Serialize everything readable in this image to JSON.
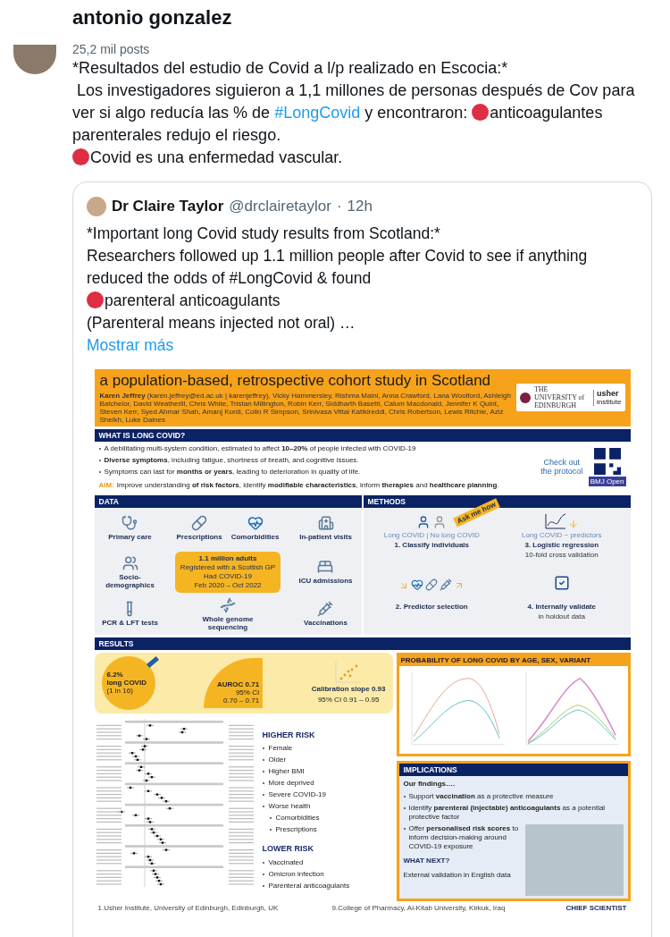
{
  "post": {
    "author": "antonio gonzalez",
    "post_count": "25,2 mil posts",
    "paragraphs": [
      {
        "segments": [
          {
            "kind": "text",
            "text": "*Resultados del estudio de Covid a l/p realizado en Escocia:*"
          }
        ]
      },
      {
        "segments": [
          {
            "kind": "text",
            "text": " Los investigadores siguieron a 1,1 millones de personas después de Cov para ver si algo reducía las % de "
          },
          {
            "kind": "hashtag",
            "text": "#LongCovid"
          },
          {
            "kind": "text",
            "text": " y encontraron: "
          },
          {
            "kind": "dot"
          },
          {
            "kind": "text",
            "text": "anticoagulantes parenterales redujo el riesgo."
          }
        ]
      },
      {
        "segments": [
          {
            "kind": "dot"
          },
          {
            "kind": "text",
            "text": "Covid es una enfermedad vascular."
          }
        ]
      }
    ]
  },
  "quote": {
    "name": "Dr Claire Taylor",
    "handle": "@drclairetaylor",
    "separator": "·",
    "time": "12h",
    "paragraphs": [
      {
        "segments": [
          {
            "kind": "text",
            "text": "*Important long Covid study results from Scotland:*"
          }
        ]
      },
      {
        "segments": [
          {
            "kind": "text",
            "text": "Researchers followed up 1.1 million people after Covid to see if anything reduced the odds of #LongCovid & found"
          }
        ]
      },
      {
        "segments": [
          {
            "kind": "dot"
          },
          {
            "kind": "text",
            "text": "parenteral anticoagulants"
          }
        ]
      },
      {
        "segments": [
          {
            "kind": "text",
            "text": "(Parenteral means injected not oral) …"
          }
        ]
      }
    ],
    "show_more": "Mostrar más"
  },
  "poster": {
    "title": "a population-based, retrospective cohort study in Scotland",
    "authors": "**Karen Jeffrey** (karen.jeffrey@ed.ac.uk | karenjeffrey), Vicky Hammersley, Rishma Maini, Anna Crawford, Lana Woolford, Ashleigh Batchelor, David Weatherill, Chris White, Tristan Millington, Robin Kerr, Siddharth Basetti, Calum Macdonald, Jennifer K Quint, Steven Kerr, Syed Ahmar Shah, Amanj Kurdi, Colin R Simpson, Srinivasa Vittal Katikireddi, Chris Robertson, Lewis Ritchie, Aziz Sheikh, Luke Daines",
    "logo_university": "THE UNIVERSITY of EDINBURGH",
    "logo_usher": "usher",
    "logo_institute": "institute",
    "what": {
      "heading": "WHAT IS LONG COVID?",
      "bullets": [
        "A debilitating multi-system condition, estimated to affect **10–20%** of people infected with COVID-19",
        "**Diverse symptoms**, including fatigue, shortness of breath, and cognitive issues.",
        "Symptoms can last for **months or years**, leading to deterioration in quality of life."
      ],
      "aim_label": "AIM:",
      "aim": "Improve understanding **of risk factors**, identify **modifiable characteristics**, inform **therapies** and **healthcare planning**.",
      "protocol": "Check out the protocol",
      "badge": "BMJ Open"
    },
    "data": {
      "heading": "DATA",
      "items": [
        "Primary care",
        "Prescriptions",
        "Comorbidities",
        "In-patient visits",
        "Socio-demographics",
        "ICU admissions",
        "PCR & LFT tests",
        "Whole genome sequencing",
        "Vaccinations"
      ],
      "center": [
        "1.1 million adults",
        "Registered with a Scottish GP",
        "Had COVID-19",
        "Feb 2020 – Oct 2022"
      ]
    },
    "methods": {
      "heading": "METHODS",
      "tag": "Ask me how",
      "classes": "Long COVID | No long COVID",
      "model": "Long COVID ~ predictors",
      "steps": [
        {
          "title": "1. Classify individuals"
        },
        {
          "title": "3. Logistic regression",
          "detail": "10-fold cross validation"
        },
        {
          "title": "2. Predictor selection"
        },
        {
          "title": "4. Internally validate",
          "detail": "in holdout data"
        }
      ]
    },
    "results": {
      "heading": "RESULTS",
      "prevalence": [
        "6.2%",
        "long COVID",
        "(1 in 16)"
      ],
      "auroc": [
        "AUROC 0.71",
        "95% CI",
        "0.70 – 0.71"
      ],
      "calibration": [
        "Calibration slope 0.93",
        "95% CI 0.91 – 0.95"
      ],
      "risk_groups": [
        {
          "heading": "HIGHER RISK",
          "items": [
            {
              "text": "Female"
            },
            {
              "text": "Older"
            },
            {
              "text": "Higher BMI"
            },
            {
              "text": "More deprived"
            },
            {
              "text": "Severe COVID-19"
            },
            {
              "text": "Worse health",
              "children": [
                {
                  "text": "Comorbidities"
                },
                {
                  "text": "Prescriptions"
                }
              ]
            }
          ]
        },
        {
          "heading": "LOWER RISK",
          "items": [
            {
              "text": "Vaccinated"
            },
            {
              "text": "Omicron infection"
            },
            {
              "text": "Parenteral anticoagulants"
            }
          ]
        }
      ]
    },
    "probability_title": "PROBABILITY OF LONG COVID BY AGE, SEX, VARIANT",
    "implications": {
      "heading": "IMPLICATIONS",
      "intro": "Our findings….",
      "bullets": [
        "Support **vaccination** as a protective measure",
        "Identify **parenteral (injectable) anticoagulants** as a potential protective factor",
        "Offer **personalised risk scores** to inform decision-making around COVID-19 exposure"
      ],
      "next_heading": "WHAT NEXT?",
      "next": "External validation in English data"
    },
    "footnotes": [
      "1.Usher Institute, University of Edinburgh, Edinburgh, UK",
      "9.College of Pharmacy, Al-Kitab University, Kirkuk, Iraq"
    ],
    "footer_logo": "CHIEF SCIENTIST"
  }
}
